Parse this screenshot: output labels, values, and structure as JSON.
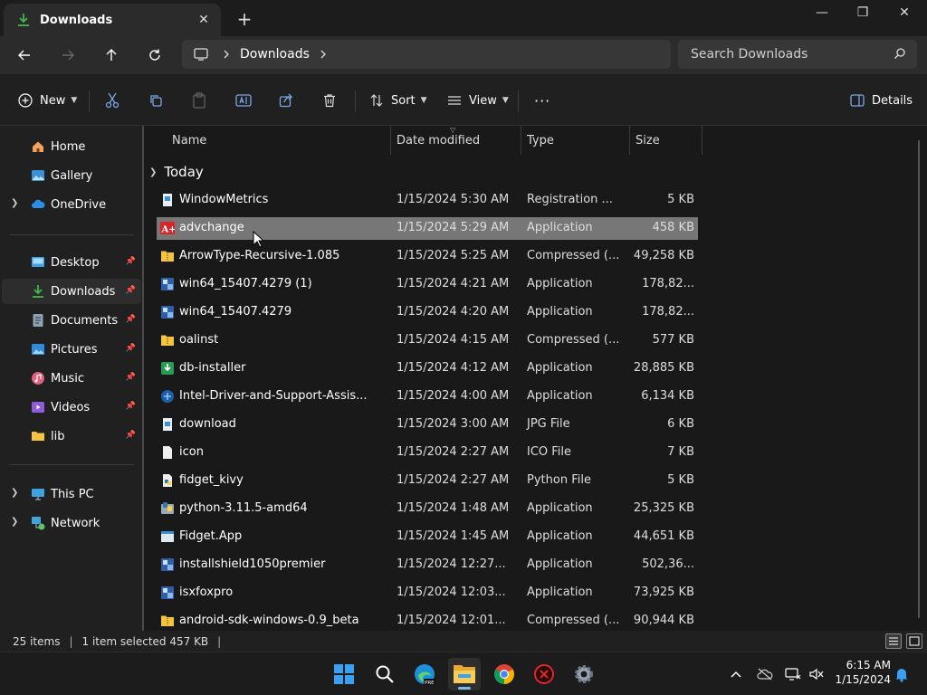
{
  "window": {
    "tab_title": "Downloads",
    "minimize_glyph": "—",
    "maximize_glyph": "❐",
    "close_glyph": "✕",
    "tab_close_glyph": "✕",
    "new_tab_glyph": "+"
  },
  "address": {
    "breadcrumb": [
      "Downloads"
    ],
    "search_placeholder": "Search Downloads"
  },
  "toolbar": {
    "new_label": "New",
    "sort_label": "Sort",
    "view_label": "View",
    "more_glyph": "···",
    "details_label": "Details"
  },
  "sidebar": {
    "top": [
      {
        "label": "Home",
        "icon": "home-icon"
      },
      {
        "label": "Gallery",
        "icon": "gallery-icon"
      },
      {
        "label": "OneDrive",
        "icon": "cloud-icon"
      }
    ],
    "pinned": [
      {
        "label": "Desktop",
        "icon": "desktop-icon"
      },
      {
        "label": "Downloads",
        "icon": "download-icon",
        "selected": true
      },
      {
        "label": "Documents",
        "icon": "documents-icon"
      },
      {
        "label": "Pictures",
        "icon": "pictures-icon"
      },
      {
        "label": "Music",
        "icon": "music-icon"
      },
      {
        "label": "Videos",
        "icon": "videos-icon"
      },
      {
        "label": "lib",
        "icon": "folder-icon"
      }
    ],
    "bottom": [
      {
        "label": "This PC",
        "icon": "this-pc-icon"
      },
      {
        "label": "Network",
        "icon": "network-icon"
      }
    ]
  },
  "columns": {
    "name": "Name",
    "date": "Date modified",
    "type": "Type",
    "size": "Size"
  },
  "group": {
    "label": "Today"
  },
  "files": [
    {
      "name": "WindowMetrics",
      "date": "1/15/2024 5:30 AM",
      "type": "Registration ...",
      "size": "5 KB",
      "icon": "registry-file-icon"
    },
    {
      "name": "advchange",
      "date": "1/15/2024 5:29 AM",
      "type": "Application",
      "size": "458 KB",
      "icon": "app-red-icon",
      "selected": true
    },
    {
      "name": "ArrowType-Recursive-1.085",
      "date": "1/15/2024 5:25 AM",
      "type": "Compressed (...",
      "size": "49,258 KB",
      "icon": "zip-folder-icon"
    },
    {
      "name": "win64_15407.4279 (1)",
      "date": "1/15/2024 4:21 AM",
      "type": "Application",
      "size": "178,82...",
      "icon": "installer-icon"
    },
    {
      "name": "win64_15407.4279",
      "date": "1/15/2024 4:20 AM",
      "type": "Application",
      "size": "178,82...",
      "icon": "installer-icon"
    },
    {
      "name": "oalinst",
      "date": "1/15/2024 4:15 AM",
      "type": "Compressed (...",
      "size": "577 KB",
      "icon": "zip-folder-icon"
    },
    {
      "name": "db-installer",
      "date": "1/15/2024 4:12 AM",
      "type": "Application",
      "size": "28,885 KB",
      "icon": "db-installer-icon"
    },
    {
      "name": "Intel-Driver-and-Support-Assis...",
      "date": "1/15/2024 4:00 AM",
      "type": "Application",
      "size": "6,134 KB",
      "icon": "intel-icon"
    },
    {
      "name": "download",
      "date": "1/15/2024 3:00 AM",
      "type": "JPG File",
      "size": "6 KB",
      "icon": "image-file-icon"
    },
    {
      "name": "icon",
      "date": "1/15/2024 2:27 AM",
      "type": "ICO File",
      "size": "7 KB",
      "icon": "blank-file-icon"
    },
    {
      "name": "fidget_kivy",
      "date": "1/15/2024 2:27 AM",
      "type": "Python File",
      "size": "5 KB",
      "icon": "python-file-icon"
    },
    {
      "name": "python-3.11.5-amd64",
      "date": "1/15/2024 1:48 AM",
      "type": "Application",
      "size": "25,325 KB",
      "icon": "python-installer-icon"
    },
    {
      "name": "Fidget.App",
      "date": "1/15/2024 1:45 AM",
      "type": "Application",
      "size": "44,651 KB",
      "icon": "app-window-icon"
    },
    {
      "name": "installshield1050premier",
      "date": "1/15/2024 12:27...",
      "type": "Application",
      "size": "502,36...",
      "icon": "installer-icon"
    },
    {
      "name": "isxfoxpro",
      "date": "1/15/2024 12:03...",
      "type": "Application",
      "size": "73,925 KB",
      "icon": "installer-icon"
    },
    {
      "name": "android-sdk-windows-0.9_beta",
      "date": "1/15/2024 12:01...",
      "type": "Compressed (...",
      "size": "90,944 KB",
      "icon": "zip-folder-icon"
    }
  ],
  "status": {
    "item_count": "25 items",
    "selection": "1 item selected  457 KB"
  },
  "taskbar": {
    "apps": [
      "start-icon",
      "search-icon",
      "edge-icon",
      "file-explorer-icon",
      "chrome-icon",
      "red-app-icon",
      "settings-icon"
    ],
    "time": "6:15 AM",
    "date": "1/15/2024"
  },
  "colors": {
    "accent": "#76b9ed",
    "selection": "#777777",
    "folder": "#f5c342",
    "download_green": "#3fb950"
  }
}
